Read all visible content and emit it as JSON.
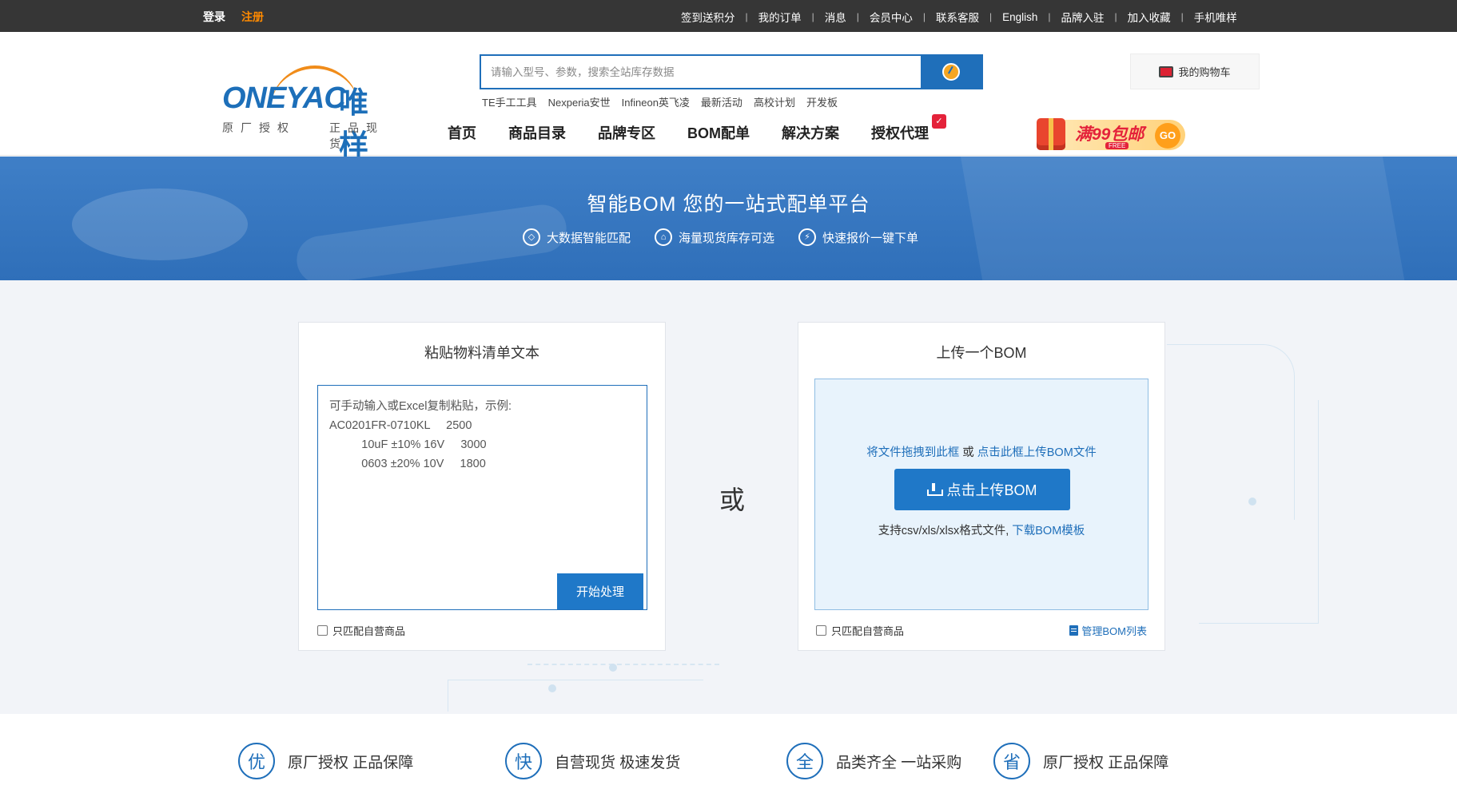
{
  "topbar": {
    "login": "登录",
    "register": "注册",
    "links": [
      "签到送积分",
      "我的订单",
      "消息",
      "会员中心",
      "联系客服",
      "English",
      "品牌入驻",
      "加入收藏",
      "手机唯样"
    ]
  },
  "header": {
    "logo_text": "ONEYAC",
    "logo_cn": "唯样",
    "slogan_left": "原厂授权",
    "slogan_right": "正品现货",
    "search_placeholder": "请输入型号、参数，搜索全站库存数据",
    "search_icon": "search-icon",
    "hot_words": [
      "TE手工工具",
      "Nexperia安世",
      "Infineon英飞凌",
      "最新活动",
      "高校计划",
      "开发板"
    ],
    "cart_label": "我的购物车",
    "nav": [
      "首页",
      "商品目录",
      "品牌专区",
      "BOM配单",
      "解决方案",
      "授权代理"
    ],
    "promo": {
      "text": "满99包邮",
      "free": "FREE",
      "go": "GO"
    }
  },
  "banner": {
    "title": "智能BOM 您的一站式配单平台",
    "features": [
      "大数据智能匹配",
      "海量现货库存可选",
      "快速报价一键下单"
    ]
  },
  "paste_panel": {
    "title": "粘贴物料清单文本",
    "placeholder": "可手动输入或Excel复制粘贴，示例:\nAC0201FR-0710KL     2500\n          10uF ±10% 16V     3000\n          0603 ±20% 10V     1800",
    "start_button": "开始处理",
    "checkbox_label": "只匹配自营商品"
  },
  "or_label": "或",
  "upload_panel": {
    "title": "上传一个BOM",
    "drag_text": "将文件拖拽到此框",
    "or_text": " 或 ",
    "click_text": "点击此框上传BOM文件",
    "upload_button": "点击上传BOM",
    "format_text": "支持csv/xls/xlsx格式文件, ",
    "template_link": "下载BOM模板",
    "checkbox_label": "只匹配自营商品",
    "manage_link": "管理BOM列表"
  },
  "bottom": [
    {
      "icon": "优",
      "text": "原厂授权 正品保障"
    },
    {
      "icon": "快",
      "text": "自营现货 极速发货"
    },
    {
      "icon": "全",
      "text": "品类齐全 一站采购"
    },
    {
      "icon": "省",
      "text": "原厂授权 正品保障"
    }
  ],
  "colors": {
    "primary": "#1f6fba",
    "accent": "#ff8a00",
    "topbar": "#363636"
  }
}
